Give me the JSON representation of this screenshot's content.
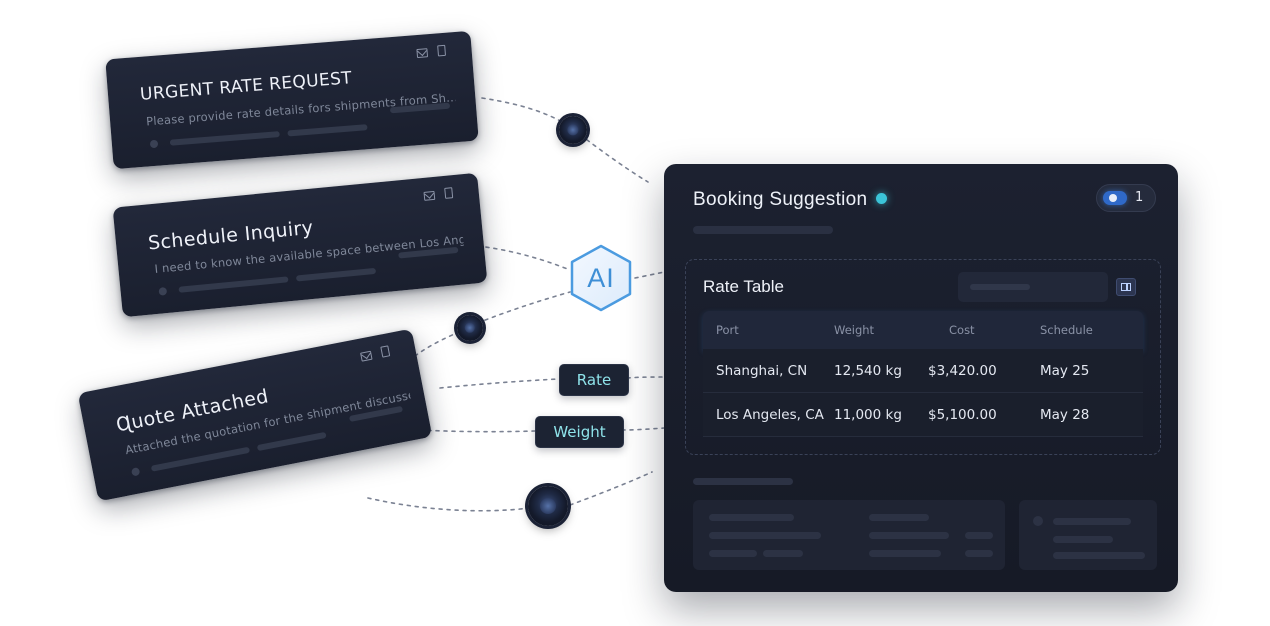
{
  "cards": [
    {
      "title": "URGENT RATE REQUEST",
      "body": "Please provide rate details fors shipments from Sh..."
    },
    {
      "title": "Schedule Inquiry",
      "body": "I need to know the available space between Los Ang..."
    },
    {
      "title": "Ɋuote Attached",
      "body": "Attached the quotation for the shipment discussed"
    }
  ],
  "ai_badge": "AI",
  "tags": {
    "rate": "Rate",
    "weight": "Weight"
  },
  "panel": {
    "title": "Booking Suggestion",
    "toggle_count": "1",
    "rate_table": {
      "title": "Rate Table",
      "columns": [
        "Port",
        "Weight",
        "Cost",
        "Schedule"
      ],
      "rows": [
        [
          "Shanghai, CN",
          "12,540 kg",
          "$3,420.00",
          "May 25"
        ],
        [
          "Los Angeles, CA",
          "11,000 kg",
          "$5,100.00",
          "May 28"
        ]
      ]
    }
  },
  "colors": {
    "accent_cyan": "#3bc4d8",
    "accent_blue": "#3e8fd6",
    "card_bg": "#1a1f2e",
    "tag_text": "#8fe3ea"
  },
  "icons": [
    "mail-icon",
    "trash-icon",
    "columns-icon",
    "toggle-switch",
    "status-dot"
  ]
}
